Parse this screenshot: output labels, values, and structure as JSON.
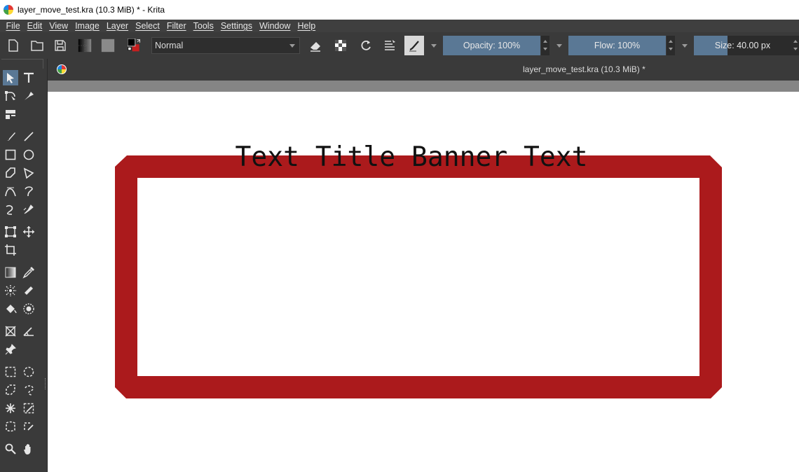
{
  "window": {
    "title": "layer_move_test.kra (10.3 MiB) * - Krita",
    "app_icon": "krita-logo-icon"
  },
  "menu": {
    "items": [
      "File",
      "Edit",
      "View",
      "Image",
      "Layer",
      "Select",
      "Filter",
      "Tools",
      "Settings",
      "Window",
      "Help"
    ]
  },
  "toolbar": {
    "blend_mode": "Normal",
    "opacity_label": "Opacity: 100%",
    "opacity_value": 1.0,
    "flow_label": "Flow: 100%",
    "flow_value": 1.0,
    "size_label": "Size: 40.00 px",
    "size_value": 40.0,
    "foreground_color": "#000000",
    "background_color": "#c51f1f",
    "accent_color": "#5a7895"
  },
  "document": {
    "tab_title": "layer_move_test.kra (10.3 MiB) *"
  },
  "canvas": {
    "banner_text": "Text Title Banner Text",
    "banner_color": "#ab1a1c"
  },
  "toolbox": {
    "tools": [
      "select-shapes-icon",
      "text-icon",
      "edit-shapes-icon",
      "calligraphy-icon",
      "pattern-icon",
      "freehand-brush-icon",
      "line-icon",
      "rectangle-icon",
      "ellipse-icon",
      "polygon-icon",
      "polyline-icon",
      "bezier-icon",
      "freehand-path-icon",
      "dynamic-brush-icon",
      "multibrush-icon",
      "transform-icon",
      "move-icon",
      "crop-icon",
      "gradient-icon",
      "color-picker-icon",
      "colorize-mask-icon",
      "smart-patch-icon",
      "fill-icon",
      "enclosed-fill-icon",
      "assistant-icon",
      "measure-icon",
      "reference-image-icon",
      "rect-select-icon",
      "ellipse-select-icon",
      "polygon-select-icon",
      "freehand-select-icon",
      "contiguous-select-icon",
      "similar-select-icon",
      "bezier-select-icon",
      "magnetic-select-icon",
      "zoom-icon",
      "pan-icon"
    ]
  }
}
